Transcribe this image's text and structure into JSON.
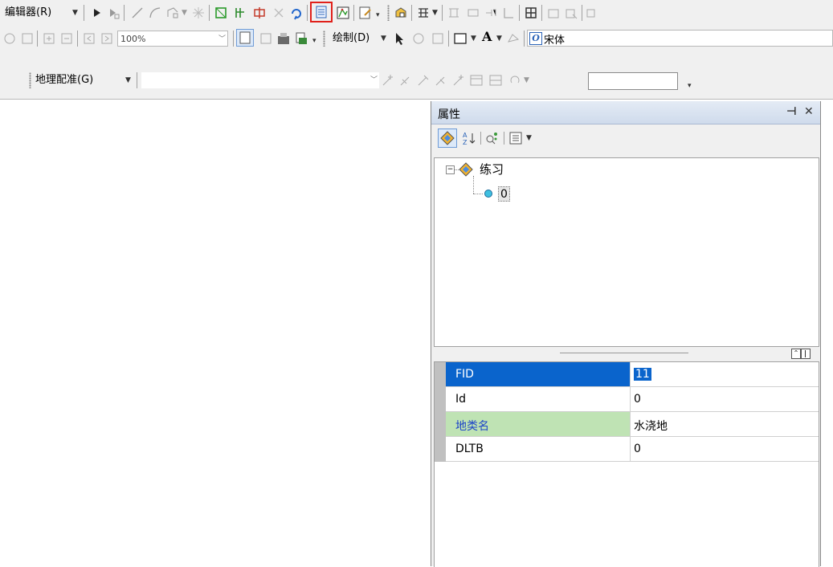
{
  "toolbar": {
    "editor_menu": "编辑器(R)",
    "zoom_value": "100%",
    "drawing_menu": "绘制(D)",
    "font_name": "宋体",
    "georef_menu": "地理配准(G)",
    "layer_combo_value": "",
    "rotation_value": ""
  },
  "properties_panel": {
    "title": "属性",
    "pin_label": "⊣",
    "close_label": "✕",
    "tree": {
      "layer_name": "练习",
      "feature_id": "0"
    },
    "attributes": [
      {
        "field": "FID",
        "value": "11"
      },
      {
        "field": "Id",
        "value": "0"
      },
      {
        "field": "地类名",
        "value": "水浇地"
      },
      {
        "field": "DLTB",
        "value": "0"
      }
    ]
  },
  "colors": {
    "selection_blue": "#0a64cc",
    "highlight_green": "#bfe3b4",
    "field_blue_text": "#1d45c8",
    "red_box": "#e0201a"
  }
}
